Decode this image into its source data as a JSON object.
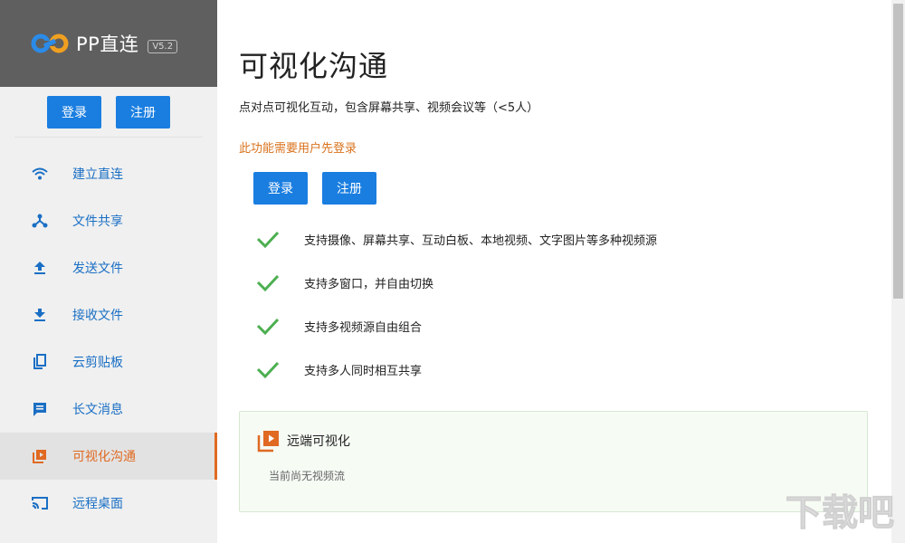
{
  "app": {
    "name": "PP直连",
    "version": "V5.2",
    "brand_colors": {
      "logo_blue": "#2b8be8",
      "logo_orange": "#f0a020",
      "accent": "#e06a22",
      "button": "#1a7ee0"
    }
  },
  "sidebar": {
    "login_label": "登录",
    "register_label": "注册",
    "items": [
      {
        "label": "建立直连",
        "icon": "wifi-icon"
      },
      {
        "label": "文件共享",
        "icon": "share-network-icon"
      },
      {
        "label": "发送文件",
        "icon": "upload-icon"
      },
      {
        "label": "接收文件",
        "icon": "download-icon"
      },
      {
        "label": "云剪贴板",
        "icon": "copy-icon"
      },
      {
        "label": "长文消息",
        "icon": "message-icon"
      },
      {
        "label": "可视化沟通",
        "icon": "video-play-icon",
        "active": true
      },
      {
        "label": "远程桌面",
        "icon": "cast-icon"
      }
    ]
  },
  "main": {
    "title": "可视化沟通",
    "description": "点对点可视化互动，包含屏幕共享、视频会议等（<5人）",
    "login_warning": "此功能需要用户先登录",
    "login_label": "登录",
    "register_label": "注册",
    "features": [
      "支持摄像、屏幕共享、互动白板、本地视频、文字图片等多种视频源",
      "支持多窗口，并自由切换",
      "支持多视频源自由组合",
      "支持多人同时相互共享"
    ],
    "remote_card": {
      "title": "远端可视化",
      "empty_text": "当前尚无视频流"
    }
  },
  "watermark": {
    "text": "下载吧",
    "icon": "download-site-watermark"
  }
}
